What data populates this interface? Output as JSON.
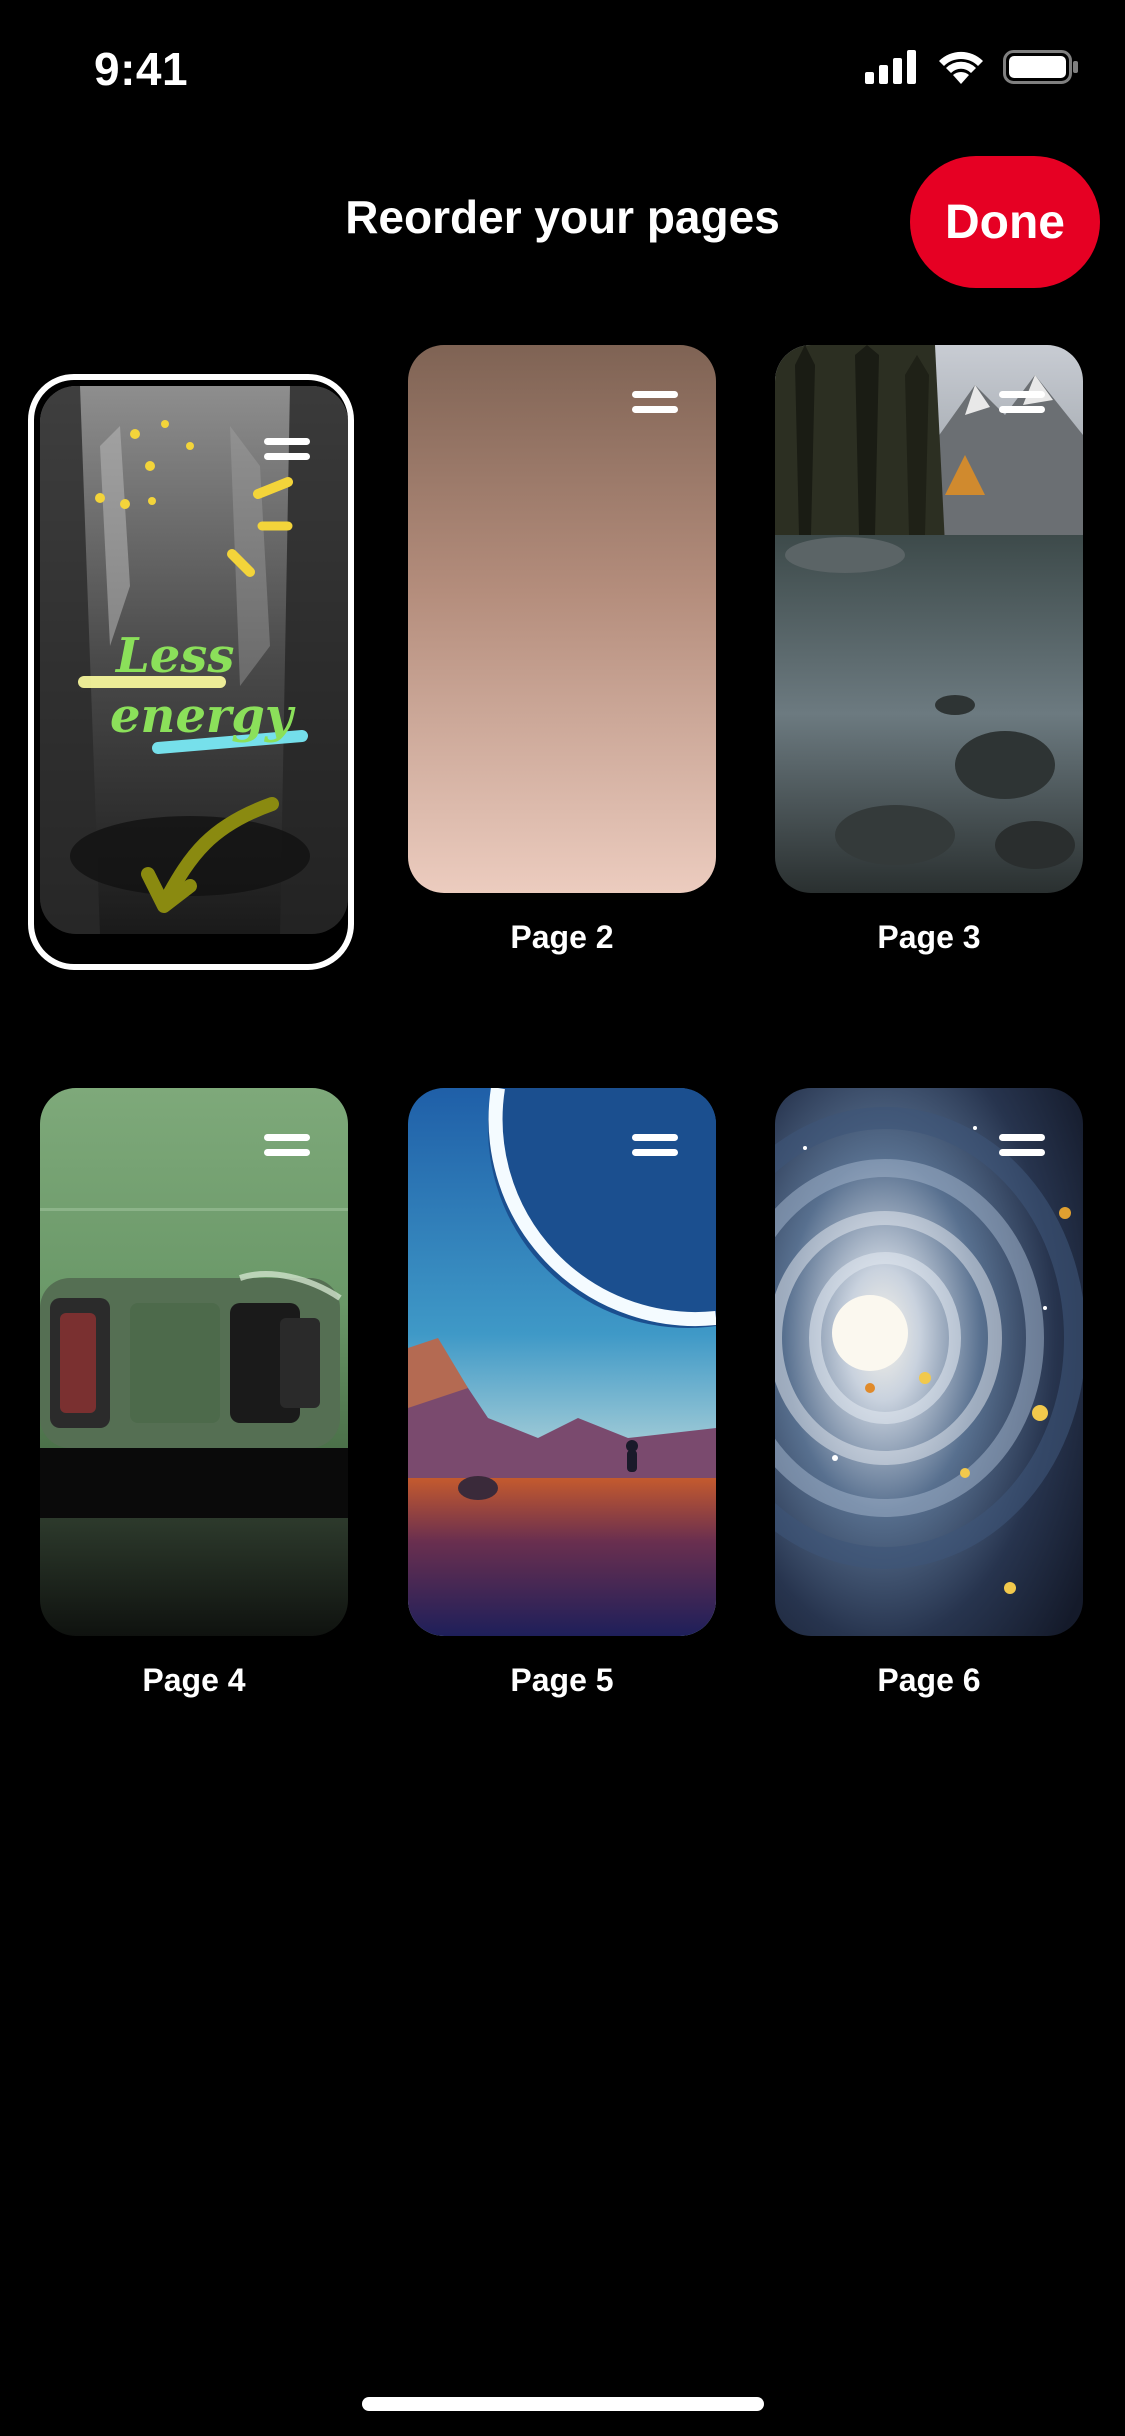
{
  "status_bar": {
    "time": "9:41",
    "icons": [
      "cellular-signal-icon",
      "wifi-icon",
      "battery-icon"
    ]
  },
  "header": {
    "title": "Reorder your pages",
    "done_label": "Done",
    "done_color": "#e60023"
  },
  "pages": [
    {
      "label": "",
      "selected": true,
      "overlay_text": [
        "Less",
        "energy"
      ]
    },
    {
      "label": "Page 2",
      "selected": false
    },
    {
      "label": "Page 3",
      "selected": false
    },
    {
      "label": "Page 4",
      "selected": false
    },
    {
      "label": "Page 5",
      "selected": false
    },
    {
      "label": "Page 6",
      "selected": false
    }
  ],
  "icons": {
    "drag_handle": "drag-handle-icon"
  }
}
